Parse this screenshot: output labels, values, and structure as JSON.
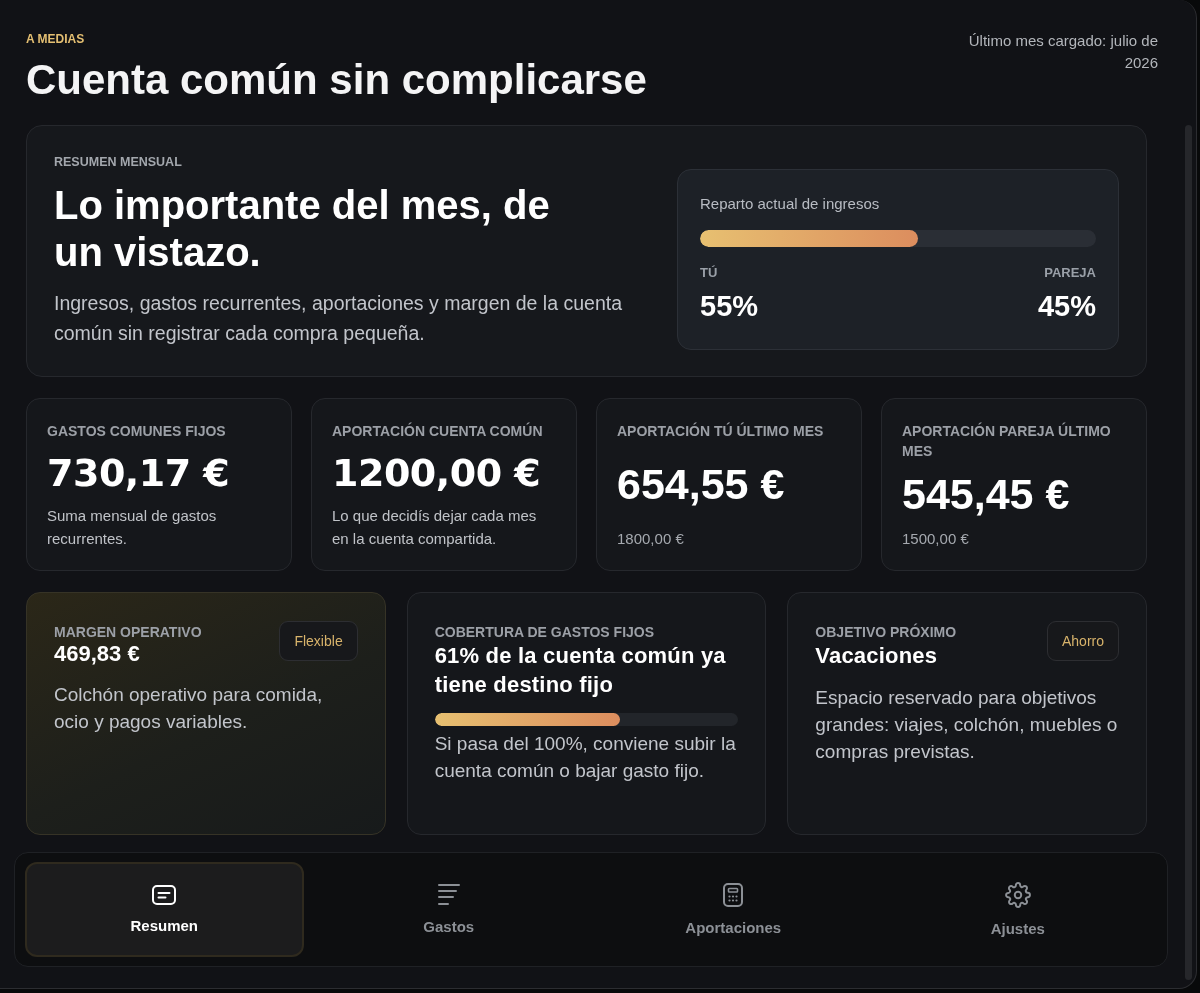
{
  "header": {
    "eyebrow": "A MEDIAS",
    "title": "Cuenta común sin complicarse",
    "last_loaded": "Último mes cargado: julio de 2026"
  },
  "summary": {
    "eyebrow": "RESUMEN MENSUAL",
    "heading": "Lo importante del mes, de un vistazo.",
    "description": "Ingresos, gastos recurrentes, aportaciones y margen de la cuenta común sin registrar cada compra pequeña.",
    "split": {
      "title": "Reparto actual de ingresos",
      "level": 0.55,
      "left_label": "TÚ",
      "left_value": "55%",
      "right_label": "PAREJA",
      "right_value": "45%"
    }
  },
  "stats": [
    {
      "kind": "total",
      "label": "GASTOS COMUNES FIJOS",
      "value": "730,17 €",
      "note": "Suma mensual de gastos recurrentes."
    },
    {
      "kind": "total",
      "label": "APORTACIÓN CUENTA COMÚN",
      "value": "1200,00 €",
      "note": "Lo que decidís dejar cada mes en la cuenta compartida."
    },
    {
      "kind": "contribution",
      "label": "APORTACIÓN TÚ ÚLTIMO MES",
      "value": "654,55 €",
      "note": "1800,00 €"
    },
    {
      "kind": "contribution",
      "label": "APORTACIÓN PAREJA ÚLTIMO MES",
      "value": "545,45 €",
      "note": "1500,00 €"
    }
  ],
  "cards": [
    {
      "kind": "amount",
      "highlighted": true,
      "label": "MARGEN OPERATIVO",
      "value": "469,83 €",
      "badge": "Flexible",
      "description": "Colchón operativo para comida, ocio y pagos variables."
    },
    {
      "kind": "progress",
      "highlighted": false,
      "label": "COBERTURA DE GASTOS FIJOS",
      "value": "61% de la cuenta común ya tiene destino fijo",
      "level": 0.61,
      "description": "Si pasa del 100%, conviene subir la cuenta común o bajar gasto fijo."
    },
    {
      "kind": "goal",
      "highlighted": false,
      "label": "OBJETIVO PRÓXIMO",
      "value": "Vacaciones",
      "badge": "Ahorro",
      "description": "Espacio reservado para objetivos grandes: viajes, colchón, muebles o compras previstas."
    }
  ],
  "nav": {
    "tabs": [
      {
        "label": "Resumen",
        "selected": true
      },
      {
        "label": "Gastos",
        "selected": false
      },
      {
        "label": "Aportaciones",
        "selected": false
      },
      {
        "label": "Ajustes",
        "selected": false
      }
    ]
  }
}
